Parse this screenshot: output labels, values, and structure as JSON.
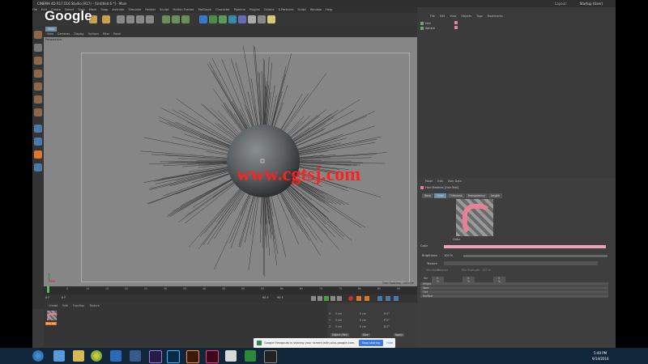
{
  "window": {
    "title": "CINEMA 4D R17.016 Studio (R17) - [Untitled 6 *] - Main",
    "layout_label": "Layout:",
    "layout_value": "Startup (User)"
  },
  "menubar": {
    "items": [
      "File",
      "Edit",
      "Create",
      "Select",
      "Tools",
      "Mesh",
      "Snap",
      "Animate",
      "Simulate",
      "Render",
      "Sculpt",
      "Motion Tracker",
      "MoGraph",
      "Character",
      "Pipeline",
      "Plugins",
      "Octane",
      "X-Particles",
      "Script",
      "Window",
      "Help"
    ]
  },
  "overlay": {
    "google_logo": "Google",
    "watermark": "www.cgtsj.com"
  },
  "viewport": {
    "tabs": [
      "View",
      "Cameras",
      "Display",
      "Options",
      "Filter",
      "Panel"
    ],
    "camera_label": "Perspective",
    "grid_spacing": "Grid Spacing : 100 cm"
  },
  "timeline": {
    "ticks": [
      "0",
      "5",
      "10",
      "15",
      "20",
      "25",
      "30",
      "35",
      "40",
      "45",
      "50",
      "55",
      "60",
      "65",
      "70",
      "75",
      "80",
      "85",
      "90"
    ],
    "current_frame": "0 F",
    "start_frame": "0 F",
    "end_frame": "90 F",
    "max_frame": "90 F"
  },
  "material_manager": {
    "menu": [
      "Create",
      "Edit",
      "Function",
      "Texture"
    ],
    "material_name": "Hair Ma"
  },
  "coordinates": {
    "rows": [
      {
        "axis": "X",
        "value": "0 cm",
        "size": "0 cm",
        "angle": "H 0°"
      },
      {
        "axis": "Y",
        "value": "0 cm",
        "size": "0 cm",
        "angle": "P 0°"
      },
      {
        "axis": "Z",
        "value": "0 cm",
        "size": "0 cm",
        "angle": "B 0°"
      }
    ],
    "mode_object": "Object (Rel)",
    "mode_size": "Size",
    "apply_button": "Apply"
  },
  "object_manager": {
    "menu": [
      "File",
      "Edit",
      "View",
      "Objects",
      "Tags",
      "Bookmarks"
    ],
    "objects": [
      {
        "name": "Hair"
      },
      {
        "name": "Sphere"
      }
    ]
  },
  "attribute_manager": {
    "menu": [
      "Mode",
      "Edit",
      "User Data"
    ],
    "title": "Hair Material [Hair Mat]",
    "tabs": [
      "Basic",
      "Color",
      "Thickness",
      "Transparency",
      "Length"
    ],
    "active_tab": "Color",
    "section_label": "Color",
    "color_label": "Color",
    "brightness_label": "Brightness",
    "brightness_value": "100 %",
    "texture_label": "Texture",
    "blend_label": "Mix Mode",
    "blend_mode": "Normal",
    "mix_strength_label": "Mix Strength",
    "mix_strength_value": "100 %",
    "variation": [
      {
        "label": "Var",
        "value": "0 %"
      },
      {
        "label": "",
        "value": "0 %"
      },
      {
        "label": "",
        "value": "0 %"
      }
    ],
    "collapsed_groups": [
      "Hilight",
      "Spec",
      "Tint",
      "Surface"
    ]
  },
  "screen_share": {
    "message": "Google Hangouts is sharing your screen with plus.google.com.",
    "stop_button": "Stop sharing",
    "hide_button": "Hide"
  },
  "taskbar": {
    "time": "5:40 PM",
    "date": "9/14/2016"
  },
  "colors": {
    "accent_pink": "#f2a0b6",
    "selected_tab": "#6d8fa8",
    "watermark_red": "#ff2020",
    "taskbar": "#12263a"
  }
}
